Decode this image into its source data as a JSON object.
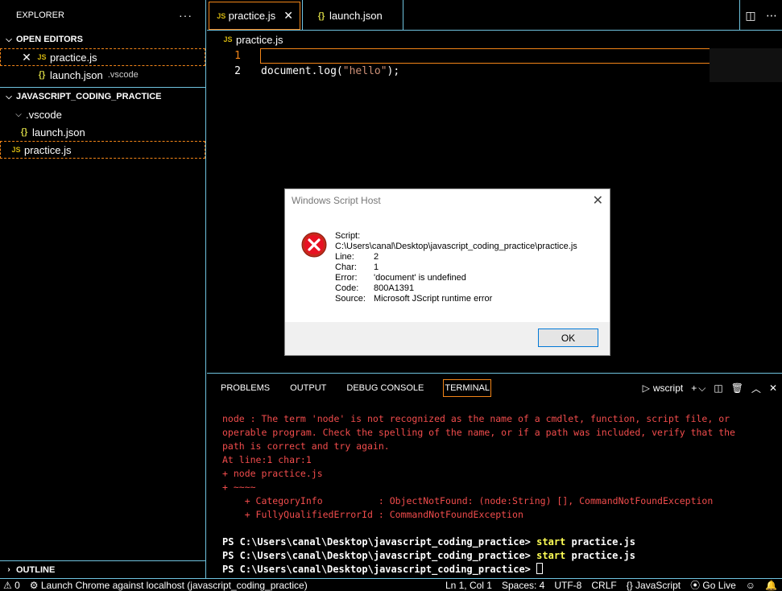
{
  "sidebar": {
    "title": "EXPLORER",
    "more": "···",
    "open_editors": {
      "label": "OPEN EDITORS",
      "items": [
        {
          "icon": "JS",
          "name": "practice.js",
          "close": "✕"
        },
        {
          "icon": "{}",
          "name": "launch.json",
          "desc": ".vscode"
        }
      ]
    },
    "project": {
      "label": "JAVASCRIPT_CODING_PRACTICE",
      "folder": ".vscode",
      "folder_child": "launch.json",
      "file": "practice.js"
    },
    "outline": "OUTLINE"
  },
  "tabs": [
    {
      "icon": "JS",
      "label": "practice.js",
      "close": "✕"
    },
    {
      "icon": "{}",
      "label": "launch.json"
    }
  ],
  "breadcrumb": {
    "icon": "JS",
    "file": "practice.js"
  },
  "editor": {
    "lines": [
      {
        "num": "1",
        "code": ""
      },
      {
        "num": "2",
        "code_pre": "document.log(",
        "code_str": "\"hello\"",
        "code_post": ");"
      }
    ]
  },
  "dialog": {
    "title": "Windows Script Host",
    "close": "✕",
    "script_label": "Script:",
    "script_path": "C:\\Users\\canal\\Desktop\\javascript_coding_practice\\practice.js",
    "fields": [
      {
        "k": "Line:",
        "v": "2"
      },
      {
        "k": "Char:",
        "v": "1"
      },
      {
        "k": "Error:",
        "v": "'document' is undefined"
      },
      {
        "k": "Code:",
        "v": "800A1391"
      },
      {
        "k": "Source:",
        "v": "Microsoft JScript runtime error"
      }
    ],
    "ok": "OK"
  },
  "panel": {
    "tabs": [
      "PROBLEMS",
      "OUTPUT",
      "DEBUG CONSOLE",
      "TERMINAL"
    ],
    "terminal_name": "wscript",
    "error_lines": [
      "node : The term 'node' is not recognized as the name of a cmdlet, function, script file, or",
      "operable program. Check the spelling of the name, or if a path was included, verify that the",
      "path is correct and try again.",
      "At line:1 char:1",
      "+ node practice.js",
      "+ ~~~~",
      "    + CategoryInfo          : ObjectNotFound: (node:String) [], CommandNotFoundException",
      "    + FullyQualifiedErrorId : CommandNotFoundException"
    ],
    "prompt": "PS C:\\Users\\canal\\Desktop\\javascript_coding_practice> ",
    "cmd_keyword": "start",
    "cmd_arg": " practice.js"
  },
  "status": {
    "warnings": "⚠ 0",
    "launch": "Launch Chrome against localhost (javascript_coding_practice)",
    "position": "Ln 1, Col 1",
    "spaces": "Spaces: 4",
    "encoding": "UTF-8",
    "eol": "CRLF",
    "language": "{} JavaScript",
    "golive": "Go Live"
  },
  "colors": {
    "accent_border": "#6fc3df",
    "focus_border": "#f38518",
    "error_text": "#f14c4c",
    "command_yellow": "#ffff55"
  }
}
